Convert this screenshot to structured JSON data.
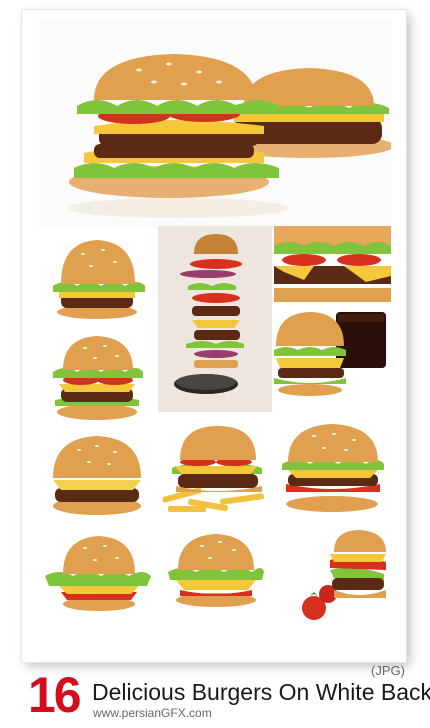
{
  "footer": {
    "count": "16",
    "title": "Delicious Burgers On White Back",
    "format": "(JPG)",
    "website": "www.persianGFX.com"
  },
  "colors": {
    "count_red": "#d40d1e",
    "bun": "#e0a050",
    "bun_dark": "#b86a22",
    "patty": "#5a2a14",
    "lettuce": "#7fc43a",
    "tomato": "#d8301e",
    "cheese": "#f4c83a"
  }
}
